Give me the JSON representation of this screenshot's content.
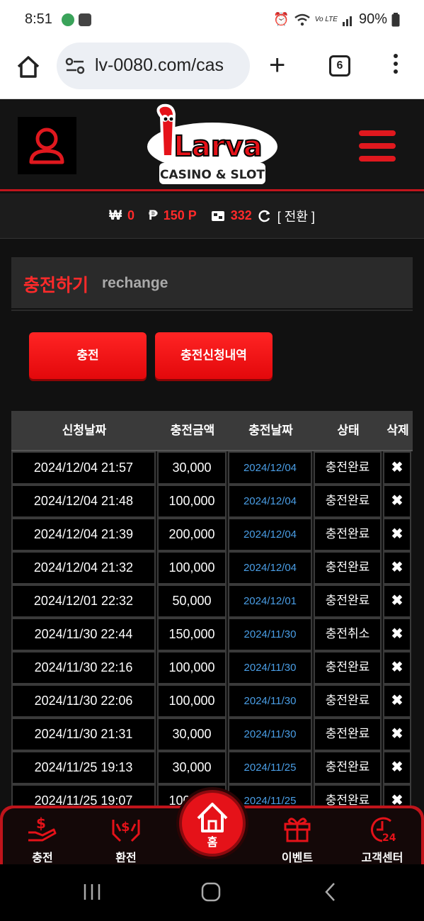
{
  "status_bar": {
    "time": "8:51",
    "battery": "90%",
    "net_label": "Vo LTE"
  },
  "browser": {
    "url": "lv-0080.com/cas",
    "tab_count": "6"
  },
  "header": {
    "logo_text": "Larva",
    "logo_sub": "CASINO & SLOT"
  },
  "balance": {
    "won_symbol": "₩",
    "won_value": "0",
    "point_symbol": "₱",
    "point_value": "150 P",
    "chip_value": "332",
    "convert_label": "[ 전환 ]"
  },
  "section": {
    "title_ko": "충전하기",
    "title_en": "rechange"
  },
  "buttons": {
    "charge": "충전",
    "history": "충전신청내역"
  },
  "table": {
    "headers": [
      "신청날짜",
      "충전금액",
      "충전날짜",
      "상태",
      "삭제"
    ],
    "rows": [
      {
        "req": "2024/12/04 21:57",
        "amount": "30,000",
        "date": "2024/12/04",
        "status": "충전완료",
        "del": "✖"
      },
      {
        "req": "2024/12/04 21:48",
        "amount": "100,000",
        "date": "2024/12/04",
        "status": "충전완료",
        "del": "✖"
      },
      {
        "req": "2024/12/04 21:39",
        "amount": "200,000",
        "date": "2024/12/04",
        "status": "충전완료",
        "del": "✖"
      },
      {
        "req": "2024/12/04 21:32",
        "amount": "100,000",
        "date": "2024/12/04",
        "status": "충전완료",
        "del": "✖"
      },
      {
        "req": "2024/12/01 22:32",
        "amount": "50,000",
        "date": "2024/12/01",
        "status": "충전완료",
        "del": "✖"
      },
      {
        "req": "2024/11/30 22:44",
        "amount": "150,000",
        "date": "2024/11/30",
        "status": "충전취소",
        "del": "✖"
      },
      {
        "req": "2024/11/30 22:16",
        "amount": "100,000",
        "date": "2024/11/30",
        "status": "충전완료",
        "del": "✖"
      },
      {
        "req": "2024/11/30 22:06",
        "amount": "100,000",
        "date": "2024/11/30",
        "status": "충전완료",
        "del": "✖"
      },
      {
        "req": "2024/11/30 21:31",
        "amount": "30,000",
        "date": "2024/11/30",
        "status": "충전완료",
        "del": "✖"
      },
      {
        "req": "2024/11/25 19:13",
        "amount": "30,000",
        "date": "2024/11/25",
        "status": "충전완료",
        "del": "✖"
      },
      {
        "req": "2024/11/25 19:07",
        "amount": "100,000",
        "date": "2024/11/25",
        "status": "충전완료",
        "del": "✖"
      }
    ]
  },
  "bottom_nav": {
    "charge": "충전",
    "exchange": "환전",
    "home": "홈",
    "event": "이벤트",
    "support": "고객센터",
    "support_badge": "24"
  },
  "colors": {
    "accent": "#e51219",
    "date_blue": "#4a9ee6"
  }
}
